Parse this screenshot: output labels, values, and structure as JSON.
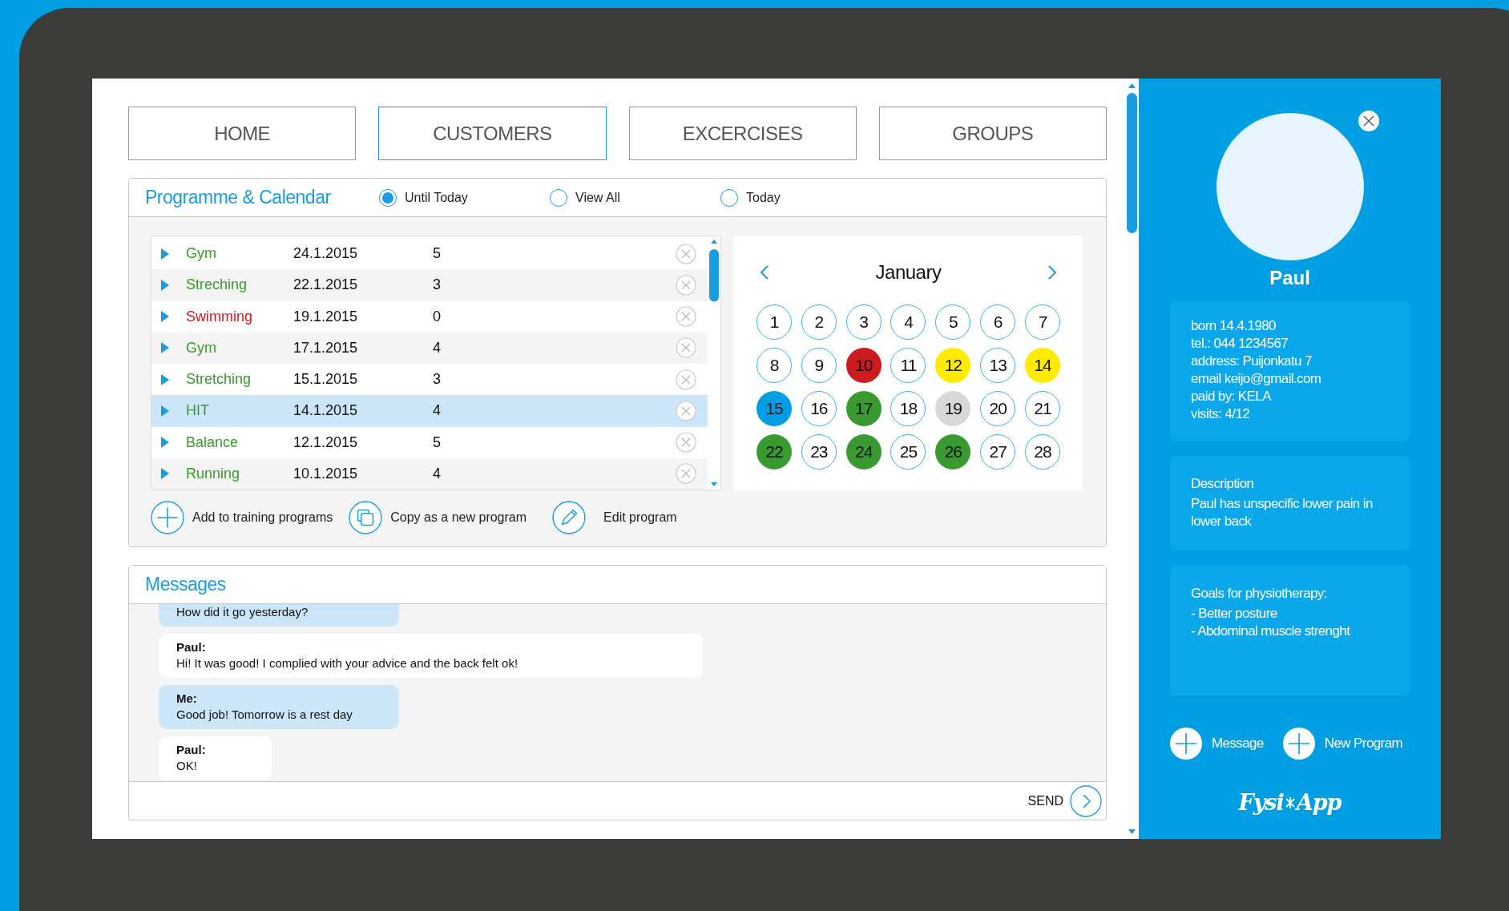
{
  "tabs": [
    {
      "label": "HOME",
      "selected": false
    },
    {
      "label": "CUSTOMERS",
      "selected": true
    },
    {
      "label": "EXCERCISES",
      "selected": false
    },
    {
      "label": "GROUPS",
      "selected": false
    }
  ],
  "programme": {
    "title": "Programme & Calendar",
    "filters": [
      {
        "label": "Until Today",
        "selected": true
      },
      {
        "label": "View All",
        "selected": false
      },
      {
        "label": "Today",
        "selected": false
      }
    ],
    "rows": [
      {
        "name": "Gym",
        "date": "24.1.2015",
        "count": "5",
        "color": "#3a9a2e",
        "selected": false
      },
      {
        "name": "Streching",
        "date": "22.1.2015",
        "count": "3",
        "color": "#3a9a2e",
        "selected": false
      },
      {
        "name": "Swimming",
        "date": "19.1.2015",
        "count": "0",
        "color": "#d0191f",
        "selected": false
      },
      {
        "name": "Gym",
        "date": "17.1.2015",
        "count": "4",
        "color": "#3a9a2e",
        "selected": false
      },
      {
        "name": "Stretching",
        "date": "15.1.2015",
        "count": "3",
        "color": "#3a9a2e",
        "selected": false
      },
      {
        "name": "HIT",
        "date": "14.1.2015",
        "count": "4",
        "color": "#3a9a2e",
        "selected": true
      },
      {
        "name": "Balance",
        "date": "12.1.2015",
        "count": "5",
        "color": "#3a9a2e",
        "selected": false
      },
      {
        "name": "Running",
        "date": "10.1.2015",
        "count": "4",
        "color": "#3a9a2e",
        "selected": false
      }
    ],
    "actions": [
      {
        "label": "Add to training programs",
        "kind": "plus"
      },
      {
        "label": "Copy as a new program",
        "kind": "copy"
      },
      {
        "label": "Edit program",
        "kind": "pencil"
      }
    ]
  },
  "calendar": {
    "month": "January",
    "days": [
      {
        "day": "1"
      },
      {
        "day": "2"
      },
      {
        "day": "3"
      },
      {
        "day": "4"
      },
      {
        "day": "5"
      },
      {
        "day": "6"
      },
      {
        "day": "7"
      },
      {
        "day": "8"
      },
      {
        "day": "9"
      },
      {
        "day": "10",
        "color": "#cc1a1f"
      },
      {
        "day": "11"
      },
      {
        "day": "12",
        "color": "#ffeb00"
      },
      {
        "day": "13"
      },
      {
        "day": "14",
        "color": "#ffeb00"
      },
      {
        "day": "15",
        "color": "#009fe3"
      },
      {
        "day": "16"
      },
      {
        "day": "17",
        "color": "#3a9a32"
      },
      {
        "day": "18"
      },
      {
        "day": "19",
        "color": "#d8d8d8"
      },
      {
        "day": "20"
      },
      {
        "day": "21"
      },
      {
        "day": "22",
        "color": "#3a9a32"
      },
      {
        "day": "23"
      },
      {
        "day": "24",
        "color": "#3a9a32"
      },
      {
        "day": "25"
      },
      {
        "day": "26",
        "color": "#3a9a32"
      },
      {
        "day": "27"
      },
      {
        "day": "28"
      }
    ]
  },
  "messages": {
    "title": "Messages",
    "items": [
      {
        "kind": "me",
        "text": "How did it go yesterday?"
      },
      {
        "kind": "client",
        "sender": "Paul:",
        "text": "Hi! It was good! I complied with your advice and the back felt ok!"
      },
      {
        "kind": "me",
        "sender": "Me:",
        "text": "Good job! Tomorrow is a rest day"
      },
      {
        "kind": "client",
        "sender": "Paul:",
        "text": "OK!"
      }
    ],
    "send": "SEND"
  },
  "client": {
    "name": "Paul",
    "info": [
      "born  14.4.1980",
      "tel.: 044 1234567",
      "address: Puijonkatu 7",
      "email keijo@gmail.com",
      "paid by: KELA",
      "visits: 4/12"
    ],
    "description": {
      "title": "Description",
      "text": "Paul has unspecific lower pain in lower back"
    },
    "goals": {
      "title": "Goals for physiotherapy:",
      "items": [
        "- Better posture",
        "- Abdominal muscle strenght"
      ]
    },
    "actions": [
      "Message",
      "New Program"
    ],
    "logo": [
      "Fysi",
      "App"
    ]
  }
}
